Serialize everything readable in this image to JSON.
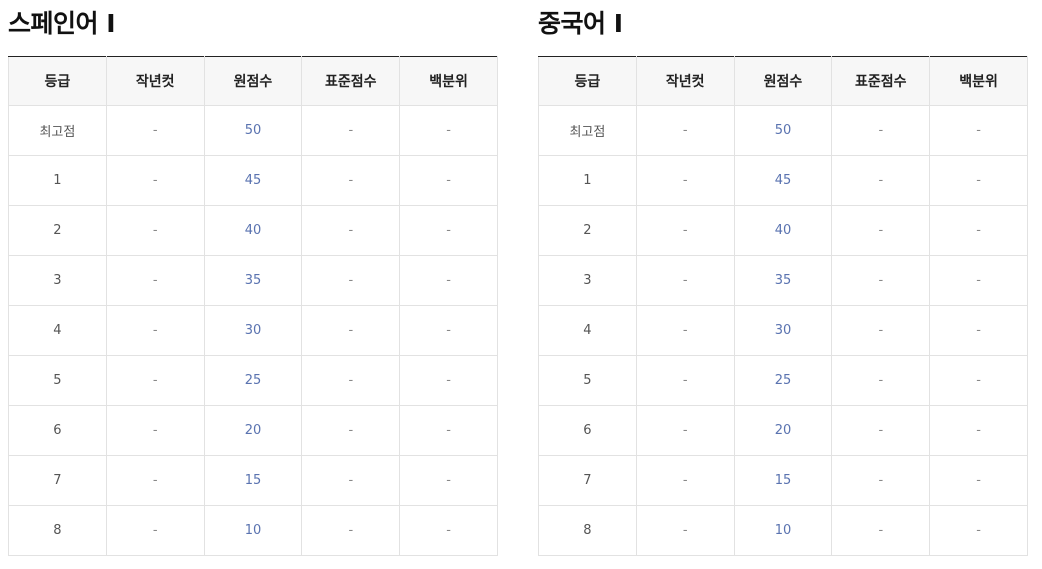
{
  "columns": [
    "등급",
    "작년컷",
    "원점수",
    "표준점수",
    "백분위"
  ],
  "tables": [
    {
      "title": "스페인어 I",
      "rows": [
        [
          "최고점",
          "-",
          "50",
          "-",
          "-"
        ],
        [
          "1",
          "-",
          "45",
          "-",
          "-"
        ],
        [
          "2",
          "-",
          "40",
          "-",
          "-"
        ],
        [
          "3",
          "-",
          "35",
          "-",
          "-"
        ],
        [
          "4",
          "-",
          "30",
          "-",
          "-"
        ],
        [
          "5",
          "-",
          "25",
          "-",
          "-"
        ],
        [
          "6",
          "-",
          "20",
          "-",
          "-"
        ],
        [
          "7",
          "-",
          "15",
          "-",
          "-"
        ],
        [
          "8",
          "-",
          "10",
          "-",
          "-"
        ]
      ]
    },
    {
      "title": "중국어 I",
      "rows": [
        [
          "최고점",
          "-",
          "50",
          "-",
          "-"
        ],
        [
          "1",
          "-",
          "45",
          "-",
          "-"
        ],
        [
          "2",
          "-",
          "40",
          "-",
          "-"
        ],
        [
          "3",
          "-",
          "35",
          "-",
          "-"
        ],
        [
          "4",
          "-",
          "30",
          "-",
          "-"
        ],
        [
          "5",
          "-",
          "25",
          "-",
          "-"
        ],
        [
          "6",
          "-",
          "20",
          "-",
          "-"
        ],
        [
          "7",
          "-",
          "15",
          "-",
          "-"
        ],
        [
          "8",
          "-",
          "10",
          "-",
          "-"
        ]
      ]
    }
  ],
  "colors": {
    "header_bg": "#f7f7f7",
    "score_text": "#5a73b0",
    "top_border": "#222222",
    "cell_border": "#e2e2e2"
  }
}
